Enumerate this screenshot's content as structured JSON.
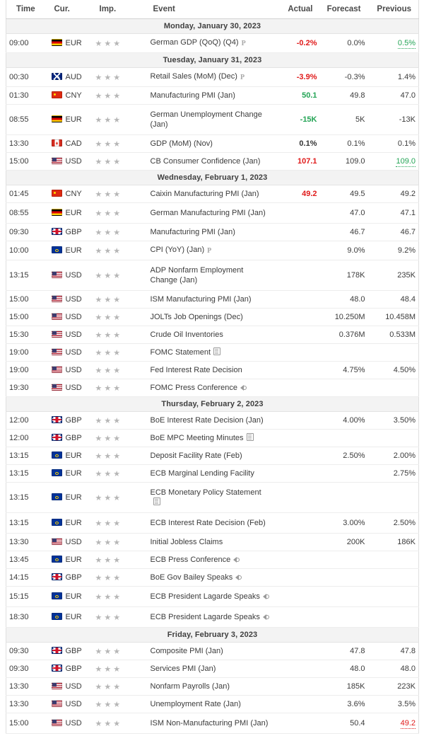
{
  "header": {
    "columns": [
      {
        "key": "time",
        "label": "Time"
      },
      {
        "key": "cur",
        "label": "Cur."
      },
      {
        "key": "imp",
        "label": "Imp."
      },
      {
        "key": "event",
        "label": "Event"
      },
      {
        "key": "actual",
        "label": "Actual"
      },
      {
        "key": "forecast",
        "label": "Forecast"
      },
      {
        "key": "previous",
        "label": "Previous"
      }
    ]
  },
  "colors": {
    "negative": "#e01a1a",
    "positive": "#23a455",
    "neutral": "#333333",
    "date_band": "#f3f3f3",
    "star": "#b6b6b6"
  },
  "legend": {
    "star_icon": "star-icon",
    "preliminary_icon": "preliminary-icon",
    "document_icon": "document-icon",
    "speaker_icon": "speaker-icon"
  },
  "groups": [
    {
      "date": "Monday, January 30, 2023",
      "rows": [
        {
          "time": "09:00",
          "flag": "de",
          "currency": "EUR",
          "stars": 3,
          "event": "German GDP (QoQ) (Q4)",
          "icon": "preliminary",
          "actual": "-0.2%",
          "actual_color": "red",
          "forecast": "0.0%",
          "previous": "0.5%",
          "previous_color": "green",
          "previous_revised": true
        }
      ]
    },
    {
      "date": "Tuesday, January 31, 2023",
      "rows": [
        {
          "time": "00:30",
          "flag": "au",
          "currency": "AUD",
          "stars": 3,
          "event": "Retail Sales (MoM) (Dec)",
          "icon": "preliminary",
          "actual": "-3.9%",
          "actual_color": "red",
          "forecast": "-0.3%",
          "previous": "1.4%"
        },
        {
          "time": "01:30",
          "flag": "cn",
          "currency": "CNY",
          "stars": 3,
          "event": "Manufacturing PMI (Jan)",
          "actual": "50.1",
          "actual_color": "green",
          "forecast": "49.8",
          "previous": "47.0"
        },
        {
          "time": "08:55",
          "flag": "de",
          "currency": "EUR",
          "stars": 3,
          "event": "German Unemployment Change (Jan)",
          "tall": true,
          "actual": "-15K",
          "actual_color": "green",
          "forecast": "5K",
          "previous": "-13K"
        },
        {
          "time": "13:30",
          "flag": "ca",
          "currency": "CAD",
          "stars": 3,
          "event": "GDP (MoM) (Nov)",
          "actual": "0.1%",
          "actual_color": "dark",
          "forecast": "0.1%",
          "previous": "0.1%"
        },
        {
          "time": "15:00",
          "flag": "us",
          "currency": "USD",
          "stars": 3,
          "event": "CB Consumer Confidence (Jan)",
          "actual": "107.1",
          "actual_color": "red",
          "forecast": "109.0",
          "previous": "109.0",
          "previous_color": "green",
          "previous_revised": true
        }
      ]
    },
    {
      "date": "Wednesday, February 1, 2023",
      "rows": [
        {
          "time": "01:45",
          "flag": "cn",
          "currency": "CNY",
          "stars": 3,
          "event": "Caixin Manufacturing PMI (Jan)",
          "actual": "49.2",
          "actual_color": "red",
          "forecast": "49.5",
          "previous": "49.2"
        },
        {
          "time": "08:55",
          "flag": "de",
          "currency": "EUR",
          "stars": 3,
          "event": "German Manufacturing PMI (Jan)",
          "tall": true,
          "actual": "",
          "forecast": "47.0",
          "previous": "47.1"
        },
        {
          "time": "09:30",
          "flag": "gb",
          "currency": "GBP",
          "stars": 3,
          "event": "Manufacturing PMI (Jan)",
          "actual": "",
          "forecast": "46.7",
          "previous": "46.7"
        },
        {
          "time": "10:00",
          "flag": "eu",
          "currency": "EUR",
          "stars": 3,
          "event": "CPI (YoY) (Jan)",
          "icon": "preliminary",
          "actual": "",
          "forecast": "9.0%",
          "previous": "9.2%"
        },
        {
          "time": "13:15",
          "flag": "us",
          "currency": "USD",
          "stars": 3,
          "event": "ADP Nonfarm Employment Change (Jan)",
          "tall": true,
          "actual": "",
          "forecast": "178K",
          "previous": "235K"
        },
        {
          "time": "15:00",
          "flag": "us",
          "currency": "USD",
          "stars": 3,
          "event": "ISM Manufacturing PMI (Jan)",
          "actual": "",
          "forecast": "48.0",
          "previous": "48.4"
        },
        {
          "time": "15:00",
          "flag": "us",
          "currency": "USD",
          "stars": 3,
          "event": "JOLTs Job Openings (Dec)",
          "actual": "",
          "forecast": "10.250M",
          "previous": "10.458M"
        },
        {
          "time": "15:30",
          "flag": "us",
          "currency": "USD",
          "stars": 3,
          "event": "Crude Oil Inventories",
          "actual": "",
          "forecast": "0.376M",
          "previous": "0.533M"
        },
        {
          "time": "19:00",
          "flag": "us",
          "currency": "USD",
          "stars": 3,
          "event": "FOMC Statement",
          "icon": "document",
          "actual": "",
          "forecast": "",
          "previous": ""
        },
        {
          "time": "19:00",
          "flag": "us",
          "currency": "USD",
          "stars": 3,
          "event": "Fed Interest Rate Decision",
          "actual": "",
          "forecast": "4.75%",
          "previous": "4.50%"
        },
        {
          "time": "19:30",
          "flag": "us",
          "currency": "USD",
          "stars": 3,
          "event": "FOMC Press Conference",
          "icon": "speaker",
          "actual": "",
          "forecast": "",
          "previous": ""
        }
      ]
    },
    {
      "date": "Thursday, February 2, 2023",
      "rows": [
        {
          "time": "12:00",
          "flag": "gb",
          "currency": "GBP",
          "stars": 3,
          "event": "BoE Interest Rate Decision (Jan)",
          "actual": "",
          "forecast": "4.00%",
          "previous": "3.50%"
        },
        {
          "time": "12:00",
          "flag": "gb",
          "currency": "GBP",
          "stars": 3,
          "event": "BoE MPC Meeting Minutes",
          "icon": "document",
          "actual": "",
          "forecast": "",
          "previous": ""
        },
        {
          "time": "13:15",
          "flag": "eu",
          "currency": "EUR",
          "stars": 3,
          "event": "Deposit Facility Rate (Feb)",
          "actual": "",
          "forecast": "2.50%",
          "previous": "2.00%"
        },
        {
          "time": "13:15",
          "flag": "eu",
          "currency": "EUR",
          "stars": 3,
          "event": "ECB Marginal Lending Facility",
          "actual": "",
          "forecast": "",
          "previous": "2.75%"
        },
        {
          "time": "13:15",
          "flag": "eu",
          "currency": "EUR",
          "stars": 3,
          "event": "ECB Monetary Policy Statement",
          "icon": "document",
          "tall": true,
          "actual": "",
          "forecast": "",
          "previous": ""
        },
        {
          "time": "13:15",
          "flag": "eu",
          "currency": "EUR",
          "stars": 3,
          "event": "ECB Interest Rate Decision (Feb)",
          "tall": true,
          "actual": "",
          "forecast": "3.00%",
          "previous": "2.50%"
        },
        {
          "time": "13:30",
          "flag": "us",
          "currency": "USD",
          "stars": 3,
          "event": "Initial Jobless Claims",
          "actual": "",
          "forecast": "200K",
          "previous": "186K"
        },
        {
          "time": "13:45",
          "flag": "eu",
          "currency": "EUR",
          "stars": 3,
          "event": "ECB Press Conference",
          "icon": "speaker",
          "actual": "",
          "forecast": "",
          "previous": ""
        },
        {
          "time": "14:15",
          "flag": "gb",
          "currency": "GBP",
          "stars": 3,
          "event": "BoE Gov Bailey Speaks",
          "icon": "speaker",
          "actual": "",
          "forecast": "",
          "previous": ""
        },
        {
          "time": "15:15",
          "flag": "eu",
          "currency": "EUR",
          "stars": 3,
          "event": "ECB President Lagarde Speaks",
          "icon": "speaker",
          "tall": true,
          "actual": "",
          "forecast": "",
          "previous": ""
        },
        {
          "time": "18:30",
          "flag": "eu",
          "currency": "EUR",
          "stars": 3,
          "event": "ECB President Lagarde Speaks",
          "icon": "speaker",
          "tall": true,
          "actual": "",
          "forecast": "",
          "previous": ""
        }
      ]
    },
    {
      "date": "Friday, February 3, 2023",
      "rows": [
        {
          "time": "09:30",
          "flag": "gb",
          "currency": "GBP",
          "stars": 3,
          "event": "Composite PMI (Jan)",
          "actual": "",
          "forecast": "47.8",
          "previous": "47.8"
        },
        {
          "time": "09:30",
          "flag": "gb",
          "currency": "GBP",
          "stars": 3,
          "event": "Services PMI (Jan)",
          "actual": "",
          "forecast": "48.0",
          "previous": "48.0"
        },
        {
          "time": "13:30",
          "flag": "us",
          "currency": "USD",
          "stars": 3,
          "event": "Nonfarm Payrolls (Jan)",
          "actual": "",
          "forecast": "185K",
          "previous": "223K"
        },
        {
          "time": "13:30",
          "flag": "us",
          "currency": "USD",
          "stars": 3,
          "event": "Unemployment Rate (Jan)",
          "actual": "",
          "forecast": "3.6%",
          "previous": "3.5%"
        },
        {
          "time": "15:00",
          "flag": "us",
          "currency": "USD",
          "stars": 3,
          "event": "ISM Non-Manufacturing PMI (Jan)",
          "tall": true,
          "actual": "",
          "forecast": "50.4",
          "previous": "49.2",
          "previous_color": "red",
          "previous_revised": true
        }
      ]
    }
  ]
}
